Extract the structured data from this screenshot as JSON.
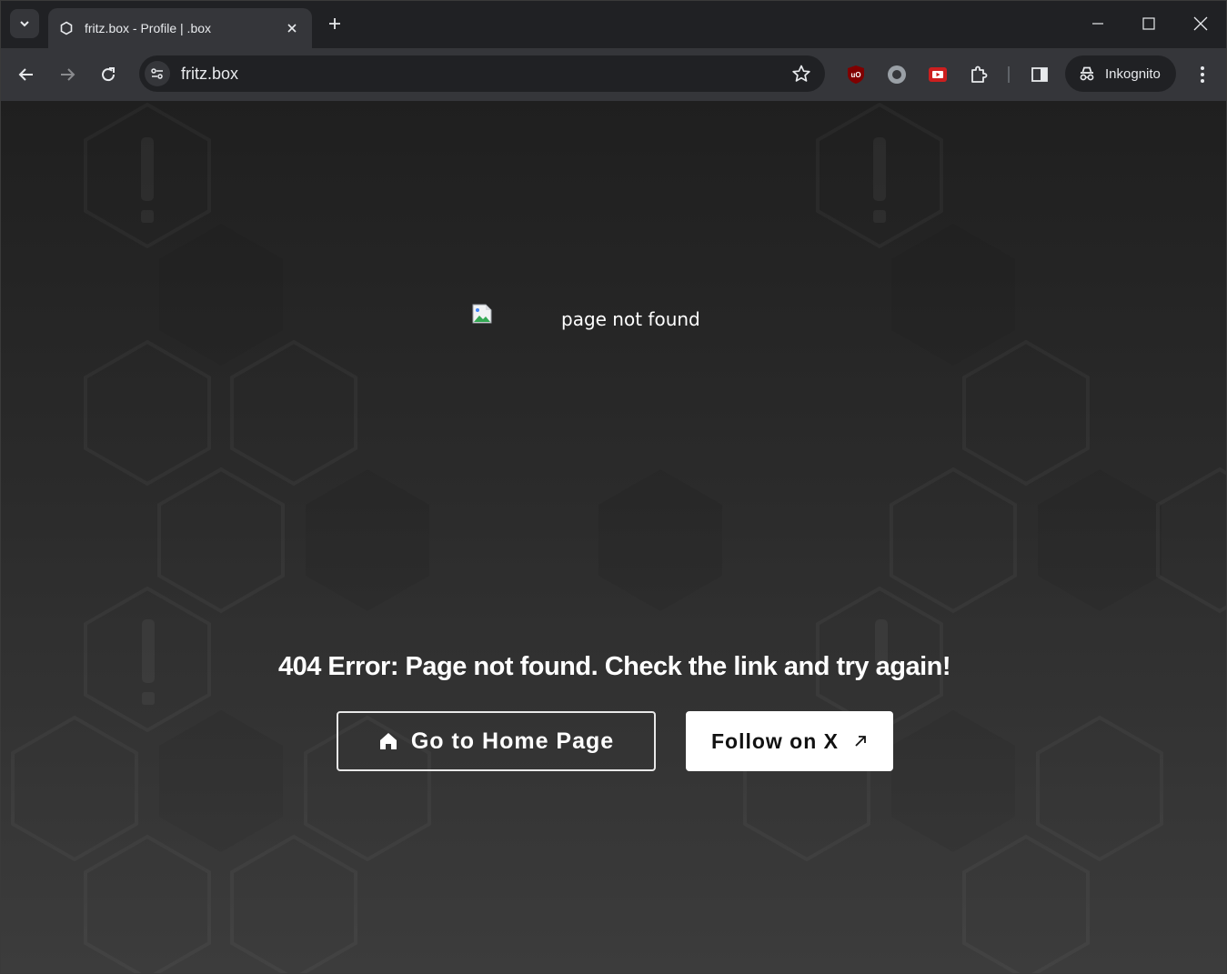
{
  "browser": {
    "tab": {
      "title": "fritz.box - Profile | .box",
      "favicon": "hexagon-icon"
    },
    "url": "fritz.box",
    "incognito_label": "Inkognito",
    "extensions": [
      "ublock-origin-icon",
      "circle-extension-icon",
      "youtube-extension-icon",
      "extensions-puzzle-icon"
    ]
  },
  "page": {
    "image_alt": "page not found",
    "error_message": "404 Error: Page not found. Check the link and try again!",
    "home_button_label": "Go to Home Page",
    "follow_button_label": "Follow on X"
  },
  "colors": {
    "tabstrip": "#202124",
    "toolbar": "#35363a",
    "text": "#e8eaed",
    "page_top": "#1f1f1f",
    "page_bottom": "#3c3c3c"
  }
}
